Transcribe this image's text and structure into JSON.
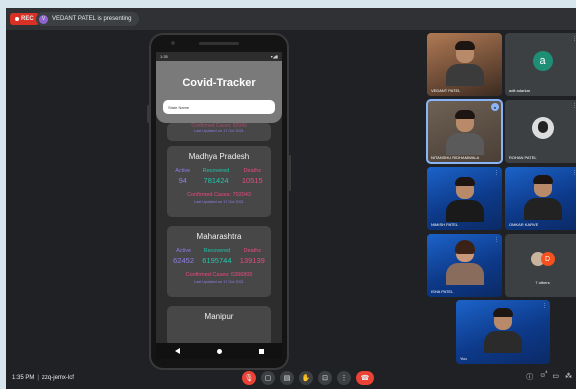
{
  "topbar": {
    "rec_label": "REC",
    "presenter_initial": "V",
    "presenting_text": "VEDANT PATEL is presenting"
  },
  "phone": {
    "status_time": "1:35",
    "status_right": "▾◢▮",
    "app_title": "Covid-Tracker",
    "search_placeholder": "State Name",
    "top_card": {
      "confirmed_partial": "Confirmed Cases: 92943",
      "updated": "Last Updated on 17 Oct 2021"
    },
    "cards": [
      {
        "state": "Madhya Pradesh",
        "active_label": "Active",
        "active": "94",
        "recovered_label": "Recovered",
        "recovered": "781424",
        "deaths_label": "Deaths",
        "deaths": "10515",
        "confirmed": "Confirmed Cases: 792043",
        "updated": "Last Updated on 17 Oct 2021"
      },
      {
        "state": "Maharashtra",
        "active_label": "Active",
        "active": "62452",
        "recovered_label": "Recovered",
        "recovered": "6195744",
        "deaths_label": "Deaths",
        "deaths": "139139",
        "confirmed": "Confirmed Cases: 6396805",
        "updated": "Last Updated on 17 Oct 2021"
      },
      {
        "state": "Manipur"
      }
    ]
  },
  "participants": [
    {
      "name": "VEDANT PATEL",
      "kind": "video"
    },
    {
      "name": "adit adarkar",
      "kind": "initial",
      "initial": "a"
    },
    {
      "name": "NITANSHU RIDHAMWALA",
      "kind": "video",
      "pinned": true
    },
    {
      "name": "ROHAN PATEL",
      "kind": "photo"
    },
    {
      "name": "NIMISH PATEL",
      "kind": "video"
    },
    {
      "name": "OMKAR KARVE",
      "kind": "video"
    },
    {
      "name": "ISHA PATEL",
      "kind": "video"
    },
    {
      "name": "7 others",
      "kind": "others",
      "badge": "D"
    },
    {
      "name": "You",
      "kind": "self"
    }
  ],
  "bottombar": {
    "time": "1:35 PM",
    "meeting_code": "zzq-jemx-lcf",
    "people_count": "4"
  },
  "colors": {
    "active": "#8f7ee6",
    "recovered": "#21c7ad",
    "deaths": "#e84b7e",
    "end_call": "#ea4335"
  }
}
